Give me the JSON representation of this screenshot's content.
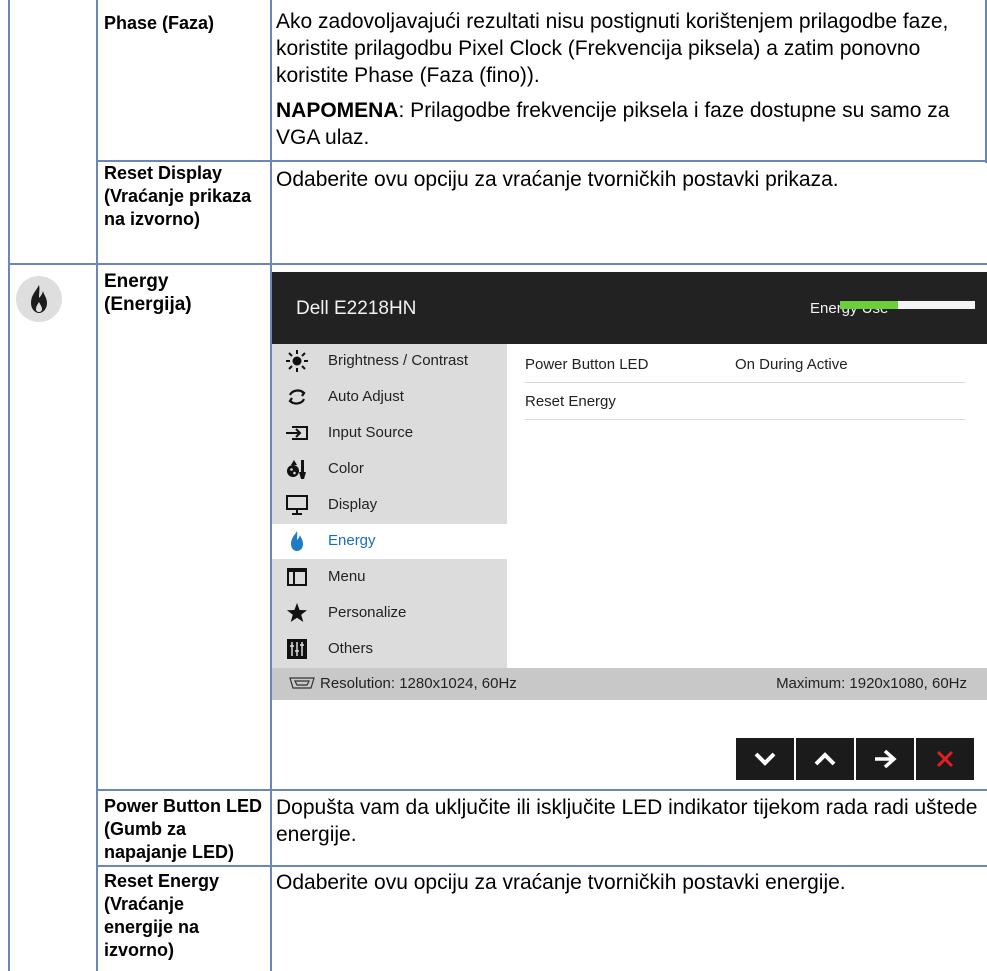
{
  "rows": [
    {
      "term": "Phase (Faza)",
      "desc": "Ako zadovoljavajući rezultati nisu postignuti korištenjem prilagodbe faze, koristite prilagodbu Pixel Clock (Frekvencija piksela) a zatim ponovno koristite Phase (Faza (fino)).",
      "note_label": "NAPOMENA",
      "note_text": ": Prilagodbe frekvencije piksela i faze dostupne su samo za VGA ulaz."
    },
    {
      "term": "Reset Display (Vraćanje prikaza na izvorno)",
      "desc": "Odaberite ovu opciju za vraćanje tvorničkih postavki prikaza."
    },
    {
      "term": "Energy (Energija)"
    },
    {
      "term": "Power Button LED (Gumb za napajanje LED)",
      "desc": "Dopušta vam da uključite ili isključite LED indikator tijekom rada radi uštede energije."
    },
    {
      "term": "Reset Energy (Vraćanje energije na izvorno)",
      "desc": "Odaberite ovu opciju za vraćanje tvorničkih postavki energije."
    }
  ],
  "osd": {
    "title": "Dell E2218HN",
    "energy_label": "Energy Use",
    "energy_use_fraction": 0.43,
    "menu": [
      {
        "label": "Brightness / Contrast",
        "icon": "sun-icon"
      },
      {
        "label": "Auto Adjust",
        "icon": "auto-adjust-icon"
      },
      {
        "label": "Input Source",
        "icon": "input-source-icon"
      },
      {
        "label": "Color",
        "icon": "color-icon"
      },
      {
        "label": "Display",
        "icon": "display-icon"
      },
      {
        "label": "Energy",
        "icon": "energy-icon",
        "active": true
      },
      {
        "label": "Menu",
        "icon": "menu-icon"
      },
      {
        "label": "Personalize",
        "icon": "star-icon"
      },
      {
        "label": "Others",
        "icon": "others-icon"
      }
    ],
    "content": [
      {
        "name": "Power Button LED",
        "value": "On During Active"
      },
      {
        "name": "Reset Energy",
        "value": ""
      }
    ],
    "status_left": "Resolution: 1280x1024, 60Hz",
    "status_right": "Maximum: 1920x1080, 60Hz"
  },
  "nav_buttons": [
    "down-arrow-icon",
    "up-arrow-icon",
    "right-arrow-icon",
    "close-icon"
  ],
  "colors": {
    "table_border": "#6b86b8",
    "energy_bar": "#6bcf3c",
    "active_menu_text": "#1a6fb5",
    "energy_icon": "#1f7bc4",
    "close_icon": "#e02020"
  }
}
